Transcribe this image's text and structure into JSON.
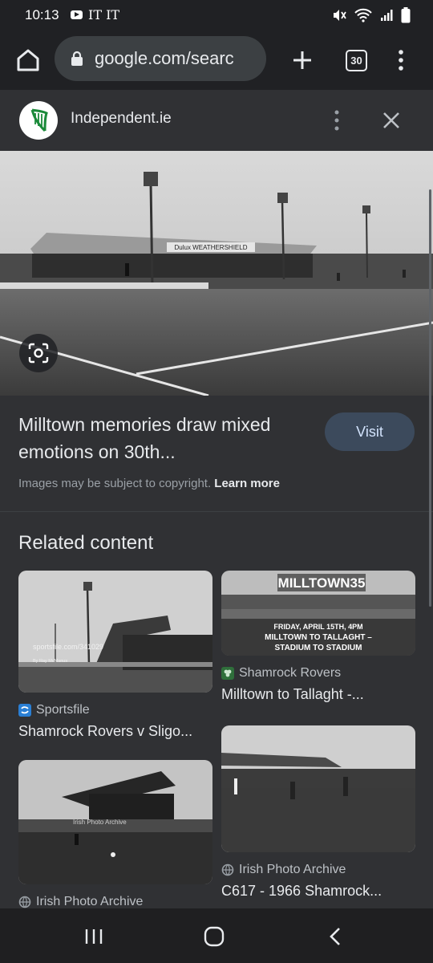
{
  "status_bar": {
    "time": "10:13",
    "extra": "IT IT"
  },
  "toolbar": {
    "url": "google.com/searc",
    "tab_count": "30"
  },
  "panel": {
    "source_name": "Independent.ie",
    "title": "Milltown memories draw mixed emotions on 30th...",
    "visit_label": "Visit",
    "copyright_text": "Images may be subject to copyright.",
    "learn_more_label": "Learn more",
    "related_heading": "Related content",
    "hero_banner": "Dulux WEATHERSHIELD"
  },
  "related": [
    {
      "source": "Sportsfile",
      "title": "Shamrock Rovers v Sligo...",
      "watermark": "sportsfile.com/341029",
      "credit": "By Ray McManus"
    },
    {
      "source": "Shamrock Rovers",
      "title": "Milltown to Tallaght -...",
      "overlay_title": "MILLTOWN35",
      "overlay_line1": "FRIDAY, APRIL 15TH, 4PM",
      "overlay_line2": "MILLTOWN TO TALLAGHT –",
      "overlay_line3": "STADIUM TO STADIUM"
    },
    {
      "source": "Irish Photo Archive",
      "title": "",
      "watermark": "Irish Photo Archive"
    },
    {
      "source": "Irish Photo Archive",
      "title": "C617 - 1966 Shamrock..."
    }
  ],
  "colors": {
    "background": "#202124",
    "panel": "#303134",
    "visit_button": "#3c4a5c",
    "harp_green": "#1b8a3a",
    "sportsfile_blue": "#2a7fd4"
  }
}
